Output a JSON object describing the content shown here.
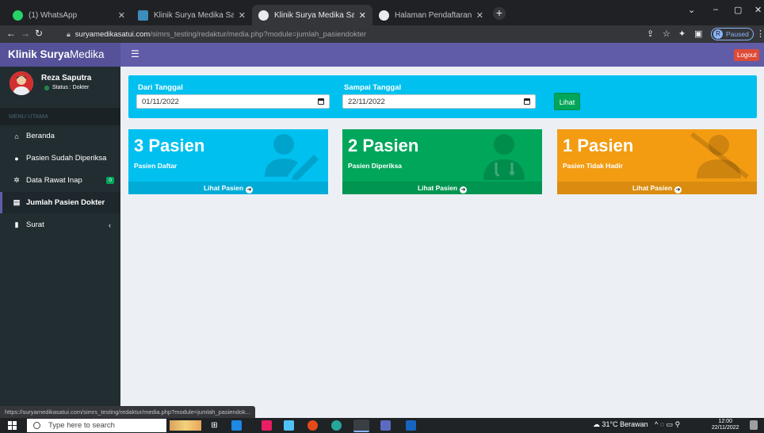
{
  "browser": {
    "tabs": [
      {
        "label": "(1) WhatsApp",
        "favicon_color": "#25d366",
        "active": false
      },
      {
        "label": "Klinik Surya Medika Satui",
        "favicon_color": "#3c8dbc",
        "active": false
      },
      {
        "label": "Klinik Surya Medika Satui",
        "favicon_color": "#e8eaed",
        "active": true
      },
      {
        "label": "Halaman Pendaftaran Pasien",
        "favicon_color": "#e8eaed",
        "active": false
      }
    ],
    "new_tab": "+",
    "window_controls": {
      "menu": "⌄",
      "minimize": "–",
      "maximize": "▢",
      "close": "✕"
    },
    "url_host": "suryamedikasatui.com",
    "url_path": "/simrs_testing/redaktur/media.php?module=jumlah_pasiendokter",
    "profile_initial": "R",
    "profile_status": "Paused",
    "status_url": "https://suryamedikasatui.com/simrs_testing/redaktur/media.php?module=jumlah_pasiendok..."
  },
  "app": {
    "brand_bold": "Klinik Surya",
    "brand_rest": "Medika",
    "logout_label": "Logout",
    "user": {
      "name": "Reza Saputra",
      "status": "Status : Dokter"
    },
    "menu_header": "MENU UTAMA",
    "menu": [
      {
        "label": "Beranda",
        "icon": "home-icon",
        "glyph": "⌂"
      },
      {
        "label": "Pasien Sudah Diperiksa",
        "icon": "user-icon",
        "glyph": "●"
      },
      {
        "label": "Data Rawat Inap",
        "icon": "cog-icon",
        "glyph": "✲",
        "badge": "0"
      },
      {
        "label": "Jumlah Pasien Dokter",
        "icon": "calendar-icon",
        "glyph": "▤",
        "active": true
      },
      {
        "label": "Surat",
        "icon": "file-icon",
        "glyph": "▮",
        "caret": "‹"
      }
    ],
    "filter": {
      "from_label": "Dari Tanggal",
      "from_value": "01/11/2022",
      "to_label": "Sampai Tanggal",
      "to_value": "22/11/2022",
      "button": "Lihat"
    },
    "boxes": [
      {
        "number": "3 Pasien",
        "label": "Pasien Daftar",
        "footer": "Lihat Pasien",
        "color": "#00c0ef",
        "footer_color": "#00acd7",
        "icon": "user-edit-icon"
      },
      {
        "number": "2 Pasien",
        "label": "Pasien Diperiksa",
        "footer": "Lihat Pasien",
        "color": "#00a65a",
        "footer_color": "#009551",
        "icon": "user-doctor-icon"
      },
      {
        "number": "1 Pasien",
        "label": "Pasien Tidak Hadir",
        "footer": "Lihat Pasien",
        "color": "#f39c12",
        "footer_color": "#da8c10",
        "icon": "user-slash-icon"
      }
    ]
  },
  "taskbar": {
    "search_placeholder": "Type here to search",
    "weather": "31°C Berawan",
    "time": "12:00",
    "date": "22/11/2022"
  }
}
